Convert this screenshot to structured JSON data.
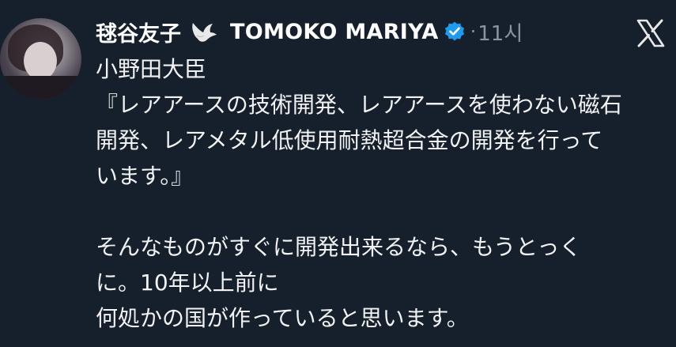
{
  "post": {
    "author_display_name": "毬谷友子",
    "author_handle_name": "TOMOKO MARIYA",
    "timestamp": "11시",
    "dot": "·",
    "lines": [
      "小野田大臣",
      "『レアアースの技術開発、レアアースを使わない磁石",
      "開発、レアメタル低使用耐熱超合金の開発を行って",
      "います。』",
      "",
      "そんなものがすぐに開発出来るなら、もうとっく",
      "に。10年以上前に",
      "何処かの国が作っていると思います。"
    ]
  },
  "icons": {
    "avatar": "avatar",
    "emoji": "dove-icon",
    "verified": "verified-badge-icon",
    "platform": "x-logo-icon"
  },
  "colors": {
    "background": "#16202c",
    "text": "#f2f2f2",
    "muted": "#8a94a0",
    "verified": "#1d9bf0"
  }
}
